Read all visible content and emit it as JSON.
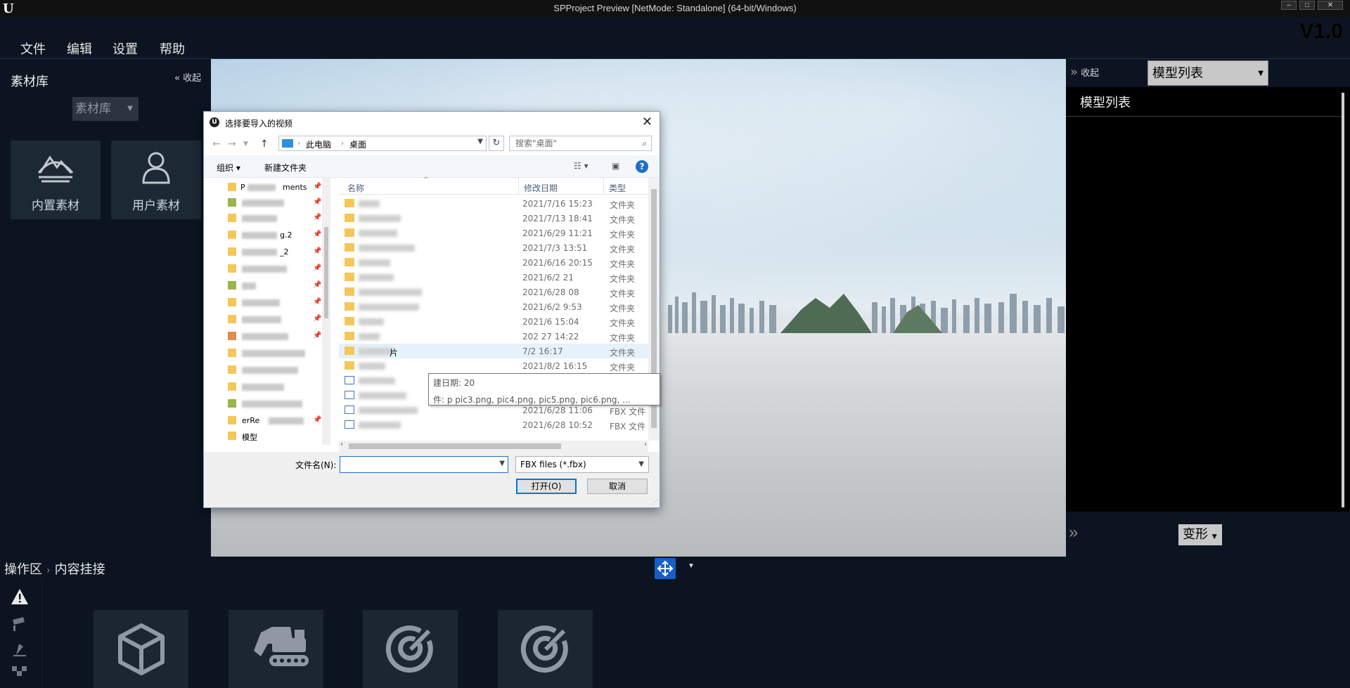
{
  "window": {
    "title": "SPProject Preview [NetMode: Standalone]  (64-bit/Windows)"
  },
  "menu": {
    "items": [
      "文件",
      "编辑",
      "设置",
      "帮助"
    ],
    "version": "V1.0"
  },
  "left_panel": {
    "title": "素材库",
    "collapse_label": "收起",
    "library_select": "素材库",
    "cards": [
      {
        "label": "内置素材",
        "icon": "mountain-icon"
      },
      {
        "label": "用户素材",
        "icon": "user-icon"
      }
    ]
  },
  "right_panel": {
    "collapse_label": "收起",
    "model_select": "模型列表",
    "list_title": "模型列表",
    "transform_button": "变形"
  },
  "bottom": {
    "breadcrumb": [
      "操作区",
      "内容挂接"
    ],
    "side_tools": [
      "warning-icon",
      "camera-icon",
      "marker-icon",
      "grid-icon"
    ],
    "cards": [
      "cube-icon",
      "excavator-icon",
      "target-icon",
      "target-icon"
    ]
  },
  "dialog": {
    "title": "选择要导入的视频",
    "address": [
      "此电脑",
      "桌面"
    ],
    "search_placeholder": "搜索\"桌面\"",
    "toolbar": {
      "organize": "组织 ▾",
      "new_folder": "新建文件夹"
    },
    "nav_items": [
      {
        "text": "P",
        "suffix": "ments"
      },
      {
        "text": ""
      },
      {
        "text": ""
      },
      {
        "text": "",
        "suffix": "g.2"
      },
      {
        "text": "",
        "suffix": "_2"
      },
      {
        "text": ""
      },
      {
        "text": ""
      },
      {
        "text": ""
      },
      {
        "text": ""
      },
      {
        "text": ""
      },
      {
        "text": ""
      },
      {
        "text": ""
      },
      {
        "text": ""
      },
      {
        "text": ""
      },
      {
        "text": ""
      },
      {
        "text": "",
        "suffix": "erRe"
      },
      {
        "text": "",
        "suffix": "模型"
      }
    ],
    "columns": {
      "name": "名称",
      "modified": "修改日期",
      "type": "类型"
    },
    "files": [
      {
        "date": "2021/7/16 15:23",
        "type": "文件夹"
      },
      {
        "date": "2021/7/13 18:41",
        "type": "文件夹"
      },
      {
        "date": "2021/6/29 11:21",
        "type": "文件夹"
      },
      {
        "date": "2021/7/3 13:51",
        "type": "文件夹"
      },
      {
        "date": "2021/6/16 20:15",
        "type": "文件夹"
      },
      {
        "date": "2021/6/2 21",
        "type": "文件夹"
      },
      {
        "date": "2021/6/28 08",
        "type": "文件夹"
      },
      {
        "date": "2021/6/2 9:53",
        "type": "文件夹"
      },
      {
        "date": "2021/6 15:04",
        "type": "文件夹"
      },
      {
        "date": "202 27 14:22",
        "type": "文件夹"
      },
      {
        "date": "7/2 16:17",
        "type": "文件夹",
        "name_tail": "片"
      },
      {
        "date": "2021/8/2 16:15",
        "type": "文件夹"
      },
      {
        "date": "",
        "type": ""
      },
      {
        "date": "",
        "type": ""
      },
      {
        "date": "2021/6/28 11:06",
        "type": "FBX 文件"
      },
      {
        "date": "2021/6/28 10:52",
        "type": "FBX 文件"
      }
    ],
    "tooltip": {
      "line1": "建日期: 20",
      "line2": "件: p         pic3.png, pic4.png, pic5.png, pic6.png, ..."
    },
    "filename_label": "文件名(N):",
    "filename_value": "",
    "filter": "FBX files (*.fbx)",
    "open_button": "打开(O)",
    "cancel_button": "取消"
  },
  "colors": {
    "accent": "#1560c8",
    "panel_bg": "#0b1420",
    "card_bg": "#1d2835"
  }
}
